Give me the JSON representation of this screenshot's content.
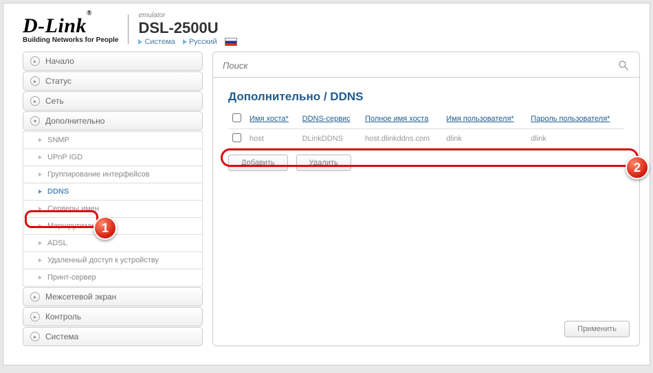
{
  "header": {
    "brand": "D-Link",
    "reg": "®",
    "tagline": "Building Networks for People",
    "emulator": "emulator",
    "model": "DSL-2500U",
    "crumb1": "Система",
    "crumb2": "Русский"
  },
  "sidebar": {
    "top": [
      {
        "label": "Начало"
      },
      {
        "label": "Статус"
      },
      {
        "label": "Сеть"
      },
      {
        "label": "Дополнительно",
        "expanded": true
      }
    ],
    "sub": [
      {
        "label": "SNMP"
      },
      {
        "label": "UPnP IGD"
      },
      {
        "label": "Группирование интерфейсов"
      },
      {
        "label": "DDNS",
        "active": true
      },
      {
        "label": "Серверы имен"
      },
      {
        "label": "Маршрутизация"
      },
      {
        "label": "ADSL"
      },
      {
        "label": "Удаленный доступ к устройству"
      },
      {
        "label": "Принт-сервер"
      }
    ],
    "bottom": [
      {
        "label": "Межсетевой экран"
      },
      {
        "label": "Контроль"
      },
      {
        "label": "Система"
      }
    ]
  },
  "search": {
    "placeholder": "Поиск"
  },
  "title": "Дополнительно / DDNS",
  "table": {
    "headers": {
      "host": "Имя хоста*",
      "service": "DDNS-сервис",
      "fullhost": "Полное имя хоста",
      "user": "Имя пользователя*",
      "pass": "Пароль пользователя*"
    },
    "row": {
      "host": "host",
      "service": "DLinkDDNS",
      "fullhost": "host.dlinkddns.com",
      "user": "dlink",
      "pass": "dlink"
    }
  },
  "buttons": {
    "add": "Добавить",
    "del": "Удалить",
    "apply": "Применить"
  },
  "callouts": {
    "one": "1",
    "two": "2"
  }
}
